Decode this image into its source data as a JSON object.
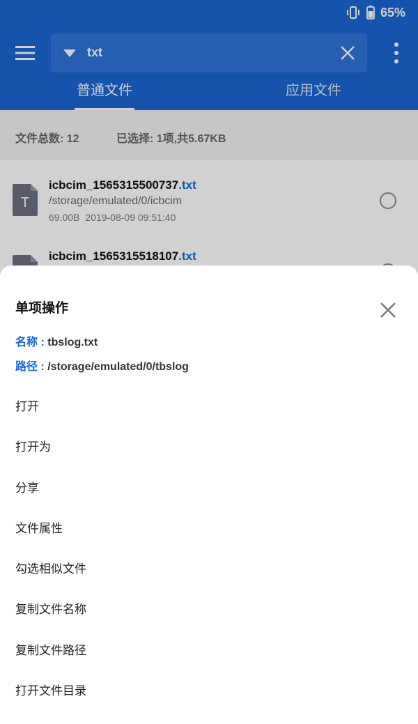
{
  "status": {
    "battery_percent": "65%",
    "icons": [
      "vibrate-icon",
      "battery-icon"
    ]
  },
  "toolbar": {
    "search_text": "txt",
    "icons": [
      "menu-icon",
      "dropdown-caret-icon",
      "clear-icon",
      "more-vert-icon"
    ]
  },
  "tabs": [
    {
      "label": "普通文件",
      "active": true
    },
    {
      "label": "应用文件",
      "active": false
    }
  ],
  "summary": {
    "total": "文件总数: 12",
    "selected": "已选择: 1项,共5.67KB"
  },
  "files": [
    {
      "name_base": "icbcim_1565315500737",
      "name_ext": ".txt",
      "path": "/storage/emulated/0/icbcim",
      "size": "69.00B",
      "date": "2019-08-09 09:51:40"
    },
    {
      "name_base": "icbcim_1565315518107",
      "name_ext": ".txt"
    }
  ],
  "sheet": {
    "title": "单项操作",
    "name_label": "名称 :",
    "name_value": "tbslog.txt",
    "path_label": "路径 :",
    "path_value": "/storage/emulated/0/tbslog",
    "actions": [
      "打开",
      "打开为",
      "分享",
      "文件属性",
      "勾选相似文件",
      "复制文件名称",
      "复制文件路径",
      "打开文件目录"
    ]
  },
  "colors": {
    "primary": "#1a66d2",
    "search_bg": "#2f75d8",
    "summary_bg": "#f2f2f2"
  }
}
